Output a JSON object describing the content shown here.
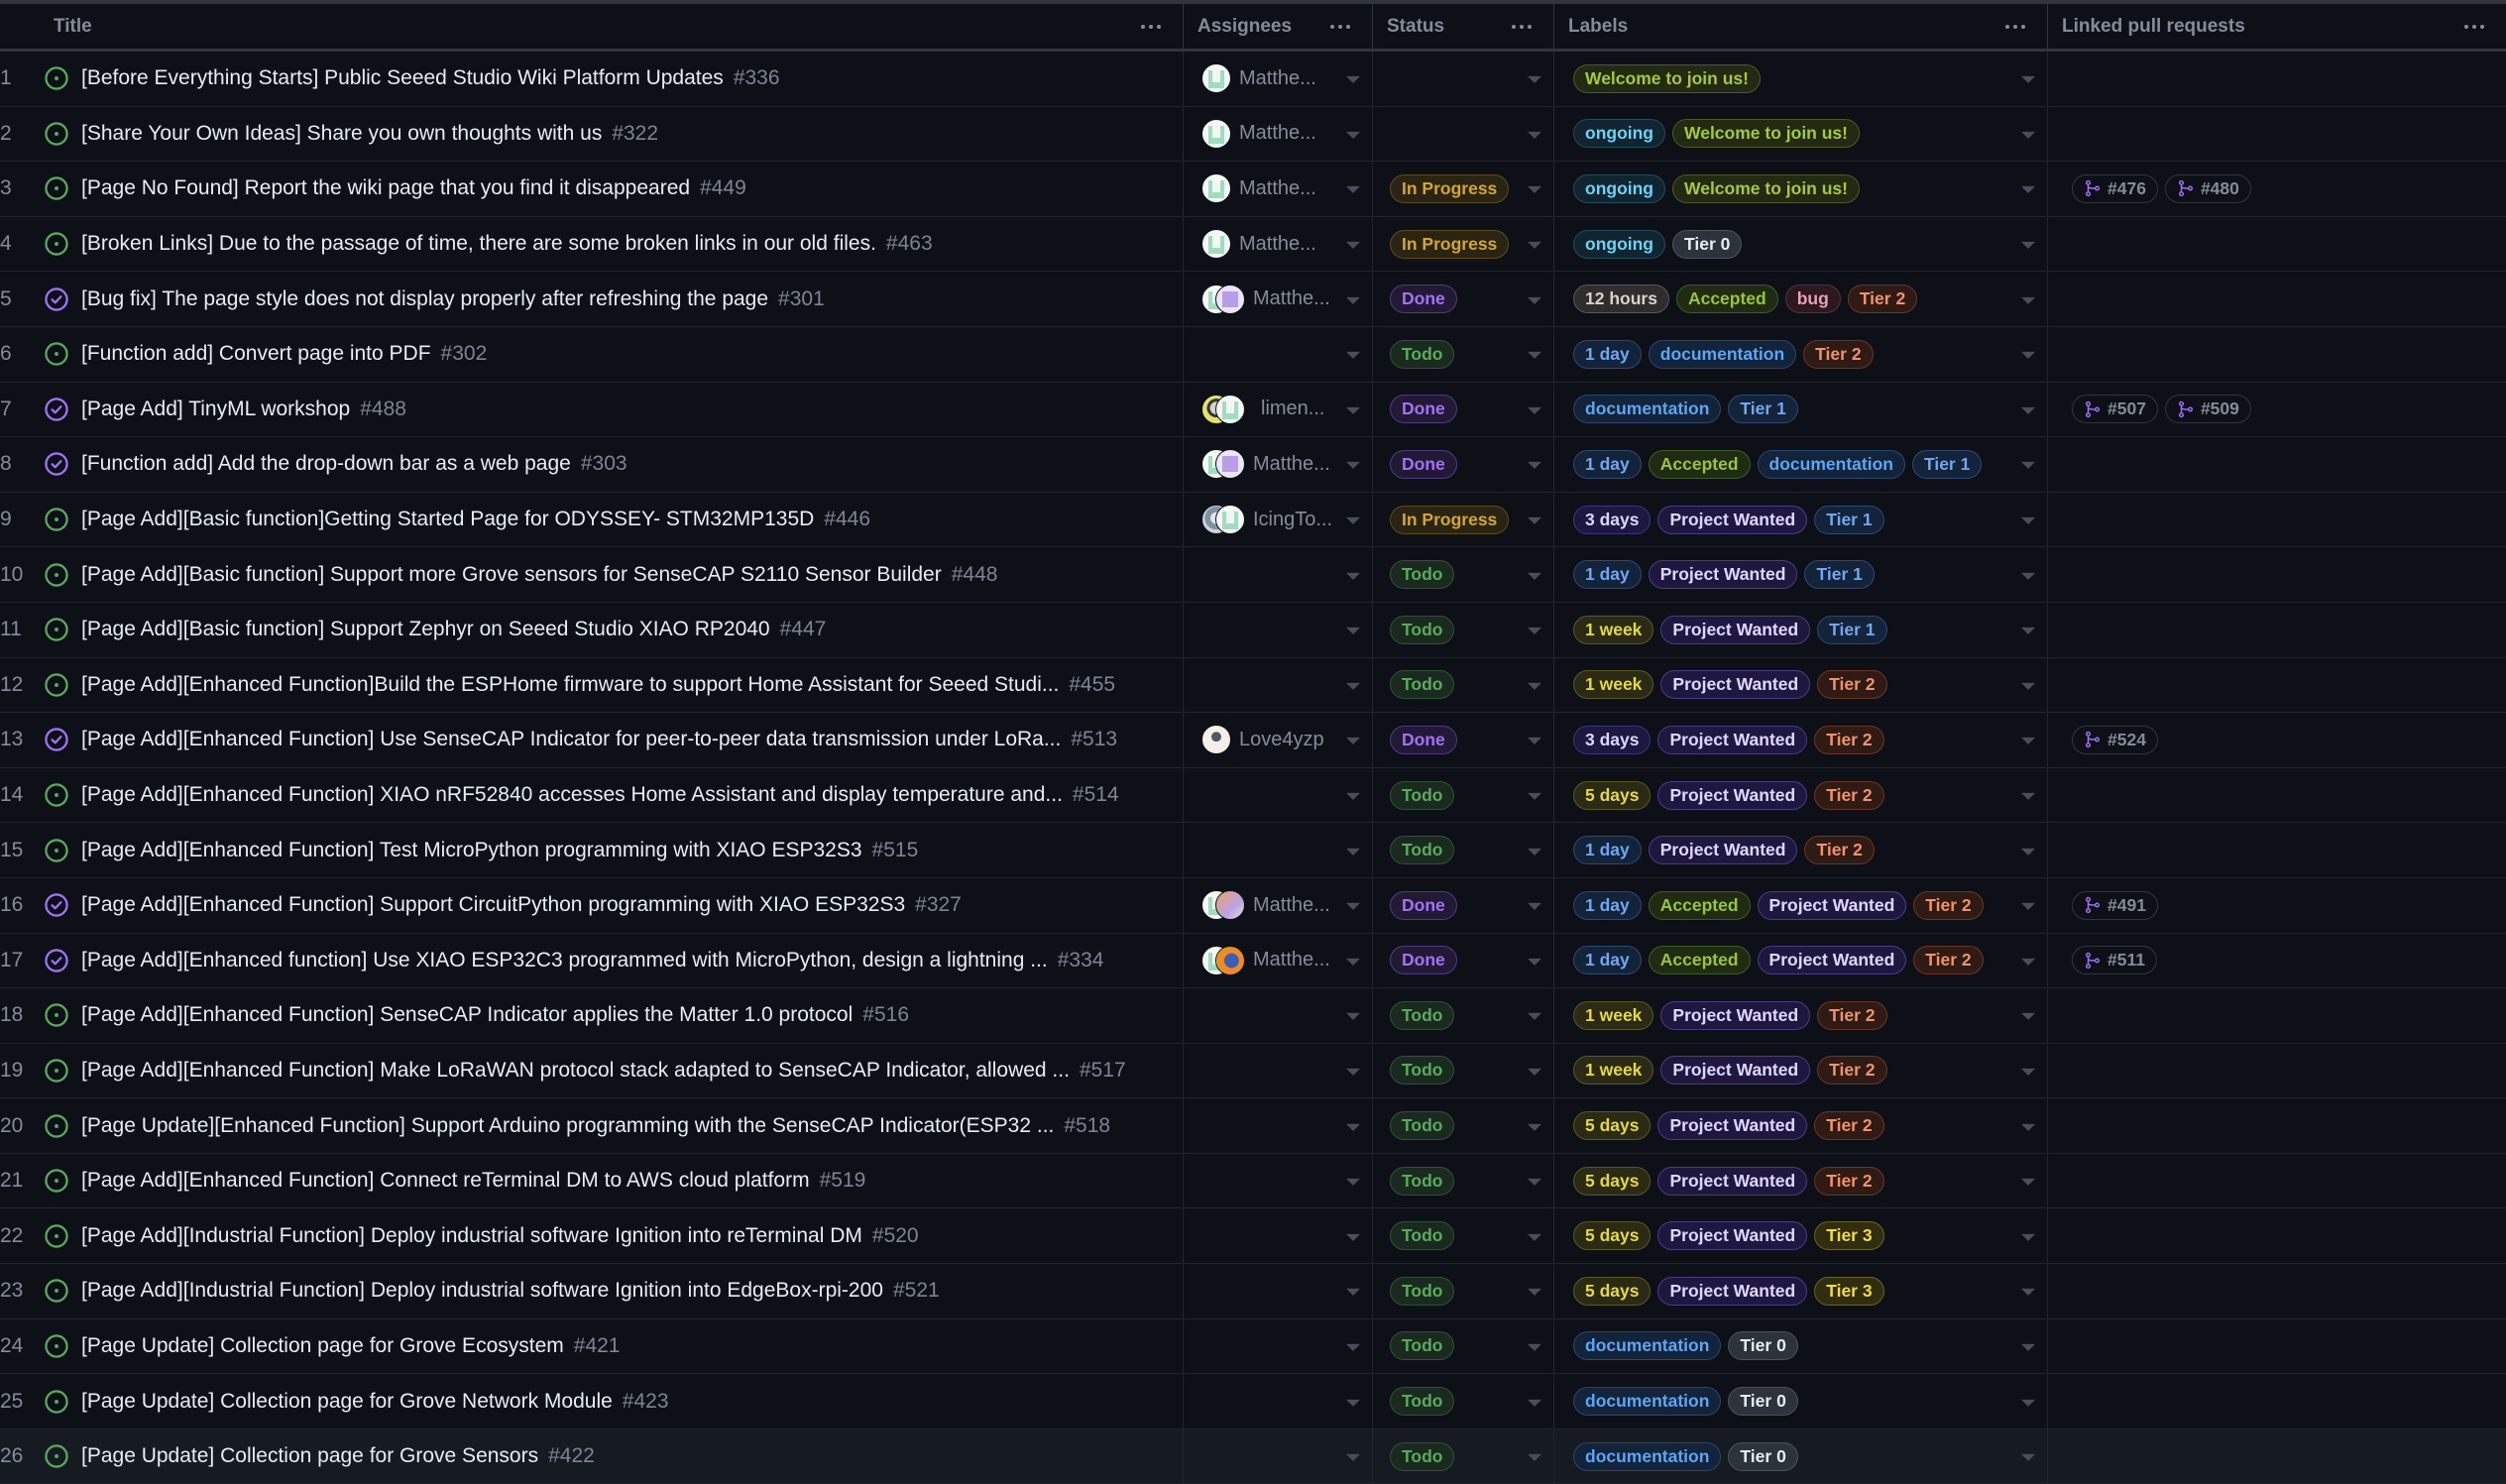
{
  "columns": {
    "title": "Title",
    "assignees": "Assignees",
    "status": "Status",
    "labels": "Labels",
    "linked_prs": "Linked pull requests"
  },
  "status_styles": {
    "Todo": {
      "fg": "#57ab5a",
      "bg": "#1b2a1f",
      "border": "#2e5233"
    },
    "In Progress": {
      "fg": "#d4a72c",
      "bg": "#2a2415",
      "border": "#5c4a17"
    },
    "Done": {
      "fg": "#a371f7",
      "bg": "#221a35",
      "border": "#4e3a80"
    }
  },
  "label_styles": {
    "Welcome to join us!": {
      "fg": "#a5c93b",
      "bg": "#222a13",
      "border": "#4b5a1e"
    },
    "ongoing": {
      "fg": "#6dd3f5",
      "bg": "#112531",
      "border": "#23495c"
    },
    "Tier 0": {
      "fg": "#e6edf3",
      "bg": "#2d333b",
      "border": "#4a525c"
    },
    "Tier 1": {
      "fg": "#6fa8f0",
      "bg": "#13233a",
      "border": "#2a4a72"
    },
    "Tier 2": {
      "fg": "#f0926a",
      "bg": "#2f1b14",
      "border": "#6a3524"
    },
    "Tier 3": {
      "fg": "#f2dc3e",
      "bg": "#302d13",
      "border": "#6a6220"
    },
    "12 hours": {
      "fg": "#dcd0c8",
      "bg": "#2f2d2d",
      "border": "#5a5656"
    },
    "Accepted": {
      "fg": "#9bc43a",
      "bg": "#1f2c13",
      "border": "#3f5a1e"
    },
    "bug": {
      "fg": "#e6a2b8",
      "bg": "#2e1820",
      "border": "#5a2e3c"
    },
    "documentation": {
      "fg": "#5aa7f5",
      "bg": "#12233a",
      "border": "#24486e"
    },
    "1 day": {
      "fg": "#6fa8f0",
      "bg": "#13233a",
      "border": "#2a4a72"
    },
    "3 days": {
      "fg": "#ddd6fe",
      "bg": "#1c1840",
      "border": "#3b3580"
    },
    "5 days": {
      "fg": "#e6d93a",
      "bg": "#2b2a14",
      "border": "#5c5720"
    },
    "1 week": {
      "fg": "#e6d93a",
      "bg": "#2b2a14",
      "border": "#5c5720"
    },
    "Project Wanted": {
      "fg": "#e0d7ff",
      "bg": "#1e1840",
      "border": "#463d82"
    }
  },
  "rows": [
    {
      "n": "1",
      "state": "open",
      "title": "[Before Everything Starts] Public Seeed Studio Wiki Platform Updates",
      "number": "#336",
      "avatars": [
        "a"
      ],
      "assignee": "Matthe...",
      "status": "",
      "labels": [
        "Welcome to join us!"
      ],
      "prs": []
    },
    {
      "n": "2",
      "state": "open",
      "title": "[Share Your Own Ideas] Share you own thoughts with us",
      "number": "#322",
      "avatars": [
        "a"
      ],
      "assignee": "Matthe...",
      "status": "",
      "labels": [
        "ongoing",
        "Welcome to join us!"
      ],
      "prs": []
    },
    {
      "n": "3",
      "state": "open",
      "title": "[Page No Found] Report the wiki page that you find it disappeared",
      "number": "#449",
      "avatars": [
        "a"
      ],
      "assignee": "Matthe...",
      "status": "In Progress",
      "labels": [
        "ongoing",
        "Welcome to join us!"
      ],
      "prs": [
        "#476",
        "#480"
      ]
    },
    {
      "n": "4",
      "state": "open",
      "title": "[Broken Links] Due to the passage of time, there are some broken links in our old files.",
      "number": "#463",
      "avatars": [
        "a"
      ],
      "assignee": "Matthe...",
      "status": "In Progress",
      "labels": [
        "ongoing",
        "Tier 0"
      ],
      "prs": []
    },
    {
      "n": "5",
      "state": "closed",
      "title": "[Bug fix] The page style does not display properly after refreshing the page",
      "number": "#301",
      "avatars": [
        "a",
        "b"
      ],
      "assignee": "Matthe...",
      "status": "Done",
      "labels": [
        "12 hours",
        "Accepted",
        "bug",
        "Tier 2"
      ],
      "prs": []
    },
    {
      "n": "6",
      "state": "open",
      "title": "[Function add] Convert page into PDF",
      "number": "#302",
      "avatars": [],
      "assignee": "",
      "status": "Todo",
      "labels": [
        "1 day",
        "documentation",
        "Tier 2"
      ],
      "prs": []
    },
    {
      "n": "7",
      "state": "closed",
      "title": "[Page Add] TinyML workshop",
      "number": "#488",
      "avatars": [
        "c",
        "a"
      ],
      "assignee": "limen...",
      "status": "Done",
      "labels": [
        "documentation",
        "Tier 1"
      ],
      "prs": [
        "#507",
        "#509"
      ]
    },
    {
      "n": "8",
      "state": "closed",
      "title": "[Function add] Add the drop-down bar as a web page",
      "number": "#303",
      "avatars": [
        "a",
        "b"
      ],
      "assignee": "Matthe...",
      "status": "Done",
      "labels": [
        "1 day",
        "Accepted",
        "documentation",
        "Tier 1"
      ],
      "prs": []
    },
    {
      "n": "9",
      "state": "open",
      "title": "[Page Add][Basic function]Getting Started Page for ODYSSEY- STM32MP135D",
      "number": "#446",
      "avatars": [
        "d",
        "a"
      ],
      "assignee": "IcingTo...",
      "status": "In Progress",
      "labels": [
        "3 days",
        "Project Wanted",
        "Tier 1"
      ],
      "prs": []
    },
    {
      "n": "10",
      "state": "open",
      "title": "[Page Add][Basic function] Support more Grove sensors for SenseCAP S2110 Sensor Builder",
      "number": "#448",
      "avatars": [],
      "assignee": "",
      "status": "Todo",
      "labels": [
        "1 day",
        "Project Wanted",
        "Tier 1"
      ],
      "prs": []
    },
    {
      "n": "11",
      "state": "open",
      "title": "[Page Add][Basic function] Support Zephyr on Seeed Studio XIAO RP2040",
      "number": "#447",
      "avatars": [],
      "assignee": "",
      "status": "Todo",
      "labels": [
        "1 week",
        "Project Wanted",
        "Tier 1"
      ],
      "prs": []
    },
    {
      "n": "12",
      "state": "open",
      "title": "[Page Add][Enhanced Function]Build the ESPHome firmware to support Home Assistant for Seeed Studi...",
      "number": "#455",
      "avatars": [],
      "assignee": "",
      "status": "Todo",
      "labels": [
        "1 week",
        "Project Wanted",
        "Tier 2"
      ],
      "prs": []
    },
    {
      "n": "13",
      "state": "closed",
      "title": "[Page Add][Enhanced Function] Use SenseCAP Indicator for peer-to-peer data transmission under LoRa...",
      "number": "#513",
      "avatars": [
        "e"
      ],
      "assignee": "Love4yzp",
      "status": "Done",
      "labels": [
        "3 days",
        "Project Wanted",
        "Tier 2"
      ],
      "prs": [
        "#524"
      ]
    },
    {
      "n": "14",
      "state": "open",
      "title": "[Page Add][Enhanced Function] XIAO nRF52840 accesses Home Assistant and display temperature and...",
      "number": "#514",
      "avatars": [],
      "assignee": "",
      "status": "Todo",
      "labels": [
        "5 days",
        "Project Wanted",
        "Tier 2"
      ],
      "prs": []
    },
    {
      "n": "15",
      "state": "open",
      "title": "[Page Add][Enhanced Function] Test MicroPython programming with XIAO ESP32S3",
      "number": "#515",
      "avatars": [],
      "assignee": "",
      "status": "Todo",
      "labels": [
        "1 day",
        "Project Wanted",
        "Tier 2"
      ],
      "prs": []
    },
    {
      "n": "16",
      "state": "closed",
      "title": "[Page Add][Enhanced Function] Support CircuitPython programming with XIAO ESP32S3",
      "number": "#327",
      "avatars": [
        "a",
        "f"
      ],
      "assignee": "Matthe...",
      "status": "Done",
      "labels": [
        "1 day",
        "Accepted",
        "Project Wanted",
        "Tier 2"
      ],
      "prs": [
        "#491"
      ]
    },
    {
      "n": "17",
      "state": "closed",
      "title": "[Page Add][Enhanced function] Use XIAO ESP32C3 programmed with MicroPython, design a lightning ...",
      "number": "#334",
      "avatars": [
        "a",
        "g"
      ],
      "assignee": "Matthe...",
      "status": "Done",
      "labels": [
        "1 day",
        "Accepted",
        "Project Wanted",
        "Tier 2"
      ],
      "prs": [
        "#511"
      ]
    },
    {
      "n": "18",
      "state": "open",
      "title": "[Page Add][Enhanced Function] SenseCAP Indicator applies the Matter 1.0 protocol",
      "number": "#516",
      "avatars": [],
      "assignee": "",
      "status": "Todo",
      "labels": [
        "1 week",
        "Project Wanted",
        "Tier 2"
      ],
      "prs": []
    },
    {
      "n": "19",
      "state": "open",
      "title": "[Page Add][Enhanced Function] Make LoRaWAN protocol stack adapted to SenseCAP Indicator, allowed ...",
      "number": "#517",
      "avatars": [],
      "assignee": "",
      "status": "Todo",
      "labels": [
        "1 week",
        "Project Wanted",
        "Tier 2"
      ],
      "prs": []
    },
    {
      "n": "20",
      "state": "open",
      "title": "[Page Update][Enhanced Function] Support Arduino programming with the SenseCAP Indicator(ESP32 ...",
      "number": "#518",
      "avatars": [],
      "assignee": "",
      "status": "Todo",
      "labels": [
        "5 days",
        "Project Wanted",
        "Tier 2"
      ],
      "prs": []
    },
    {
      "n": "21",
      "state": "open",
      "title": "[Page Add][Enhanced Function] Connect reTerminal DM to AWS cloud platform",
      "number": "#519",
      "avatars": [],
      "assignee": "",
      "status": "Todo",
      "labels": [
        "5 days",
        "Project Wanted",
        "Tier 2"
      ],
      "prs": []
    },
    {
      "n": "22",
      "state": "open",
      "title": "[Page Add][Industrial Function] Deploy industrial software Ignition into reTerminal DM",
      "number": "#520",
      "avatars": [],
      "assignee": "",
      "status": "Todo",
      "labels": [
        "5 days",
        "Project Wanted",
        "Tier 3"
      ],
      "prs": []
    },
    {
      "n": "23",
      "state": "open",
      "title": "[Page Add][Industrial Function] Deploy industrial software Ignition into EdgeBox-rpi-200",
      "number": "#521",
      "avatars": [],
      "assignee": "",
      "status": "Todo",
      "labels": [
        "5 days",
        "Project Wanted",
        "Tier 3"
      ],
      "prs": []
    },
    {
      "n": "24",
      "state": "open",
      "title": "[Page Update] Collection page for Grove Ecosystem",
      "number": "#421",
      "avatars": [],
      "assignee": "",
      "status": "Todo",
      "labels": [
        "documentation",
        "Tier 0"
      ],
      "prs": []
    },
    {
      "n": "25",
      "state": "open",
      "title": "[Page Update] Collection page for Grove Network Module",
      "number": "#423",
      "avatars": [],
      "assignee": "",
      "status": "Todo",
      "labels": [
        "documentation",
        "Tier 0"
      ],
      "prs": []
    },
    {
      "n": "26",
      "state": "open",
      "title": "[Page Update] Collection page for Grove Sensors",
      "number": "#422",
      "avatars": [],
      "assignee": "",
      "status": "Todo",
      "labels": [
        "documentation",
        "Tier 0"
      ],
      "prs": [],
      "hover": true
    }
  ],
  "icon_colors": {
    "open": "#57ab5a",
    "closed": "#a371f7",
    "pr": "#a371f7"
  }
}
